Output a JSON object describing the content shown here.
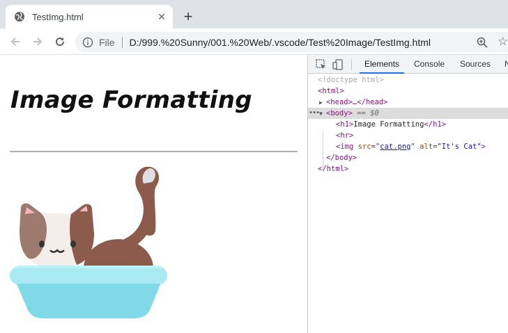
{
  "browser": {
    "tab_title": "TestImg.html",
    "new_tab": "+",
    "close": "✕",
    "scheme": "File",
    "url": "D:/999.%20Sunny/001.%20Web/.vscode/Test%20Image/TestImg.html"
  },
  "page": {
    "heading": "Image Formatting",
    "image_alt": "It's Cat"
  },
  "devtools": {
    "tabs": [
      "Elements",
      "Console",
      "Sources",
      "N"
    ],
    "active_tab": "Elements",
    "dom": {
      "doctype": "<!doctype html>",
      "html_open": "<html>",
      "head": "<head>…</head>",
      "body_open": "<body>",
      "body_marker": "== $0",
      "h1_open": "<h1>",
      "h1_text": "Image Formatting",
      "h1_close": "</h1>",
      "hr": "<hr>",
      "img_open": "<img ",
      "src_attr": "src",
      "src_val": "cat.png",
      "alt_attr": "alt",
      "alt_val": "\"It's Cat\"",
      "img_close": ">",
      "body_close": "</body>",
      "html_close": "</html>"
    }
  },
  "colors": {
    "accent": "#1a73e8",
    "tabstrip": "#dee1e6",
    "tag": "#881280",
    "attr": "#994500",
    "value": "#1a1aa6"
  }
}
